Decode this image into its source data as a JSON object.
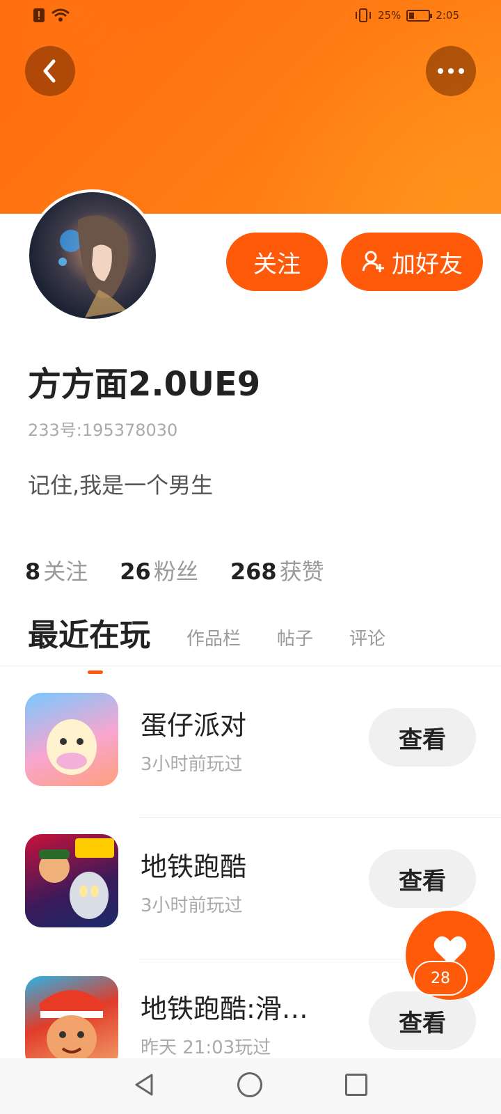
{
  "status_bar": {
    "battery_percent": "25%",
    "time": "2:05",
    "battery_level": 0.25
  },
  "header": {
    "back_icon": "chevron-left-icon",
    "more_icon": "more-horizontal-icon",
    "colors": {
      "banner": "#ff7b12",
      "accent": "#ff5a0a"
    }
  },
  "profile": {
    "follow_label": "关注",
    "add_friend_label": "加好友",
    "username": "方方面2.0UE9",
    "user_id": "233号:195378030",
    "bio": "记住,我是一个男生"
  },
  "stats": [
    {
      "num": "8",
      "label": "关注"
    },
    {
      "num": "26",
      "label": "粉丝"
    },
    {
      "num": "268",
      "label": "获赞"
    }
  ],
  "tabs": {
    "active": "最近在玩",
    "items": [
      "作品栏",
      "帖子",
      "评论"
    ]
  },
  "games": [
    {
      "title": "蛋仔派对",
      "subtitle": "3小时前玩过",
      "action": "查看"
    },
    {
      "title": "地铁跑酷",
      "subtitle": "3小时前玩过",
      "action": "查看"
    },
    {
      "title": "地铁跑酷:滑…",
      "subtitle": "昨天 21:03玩过",
      "action": "查看"
    }
  ],
  "like": {
    "count": "28"
  }
}
